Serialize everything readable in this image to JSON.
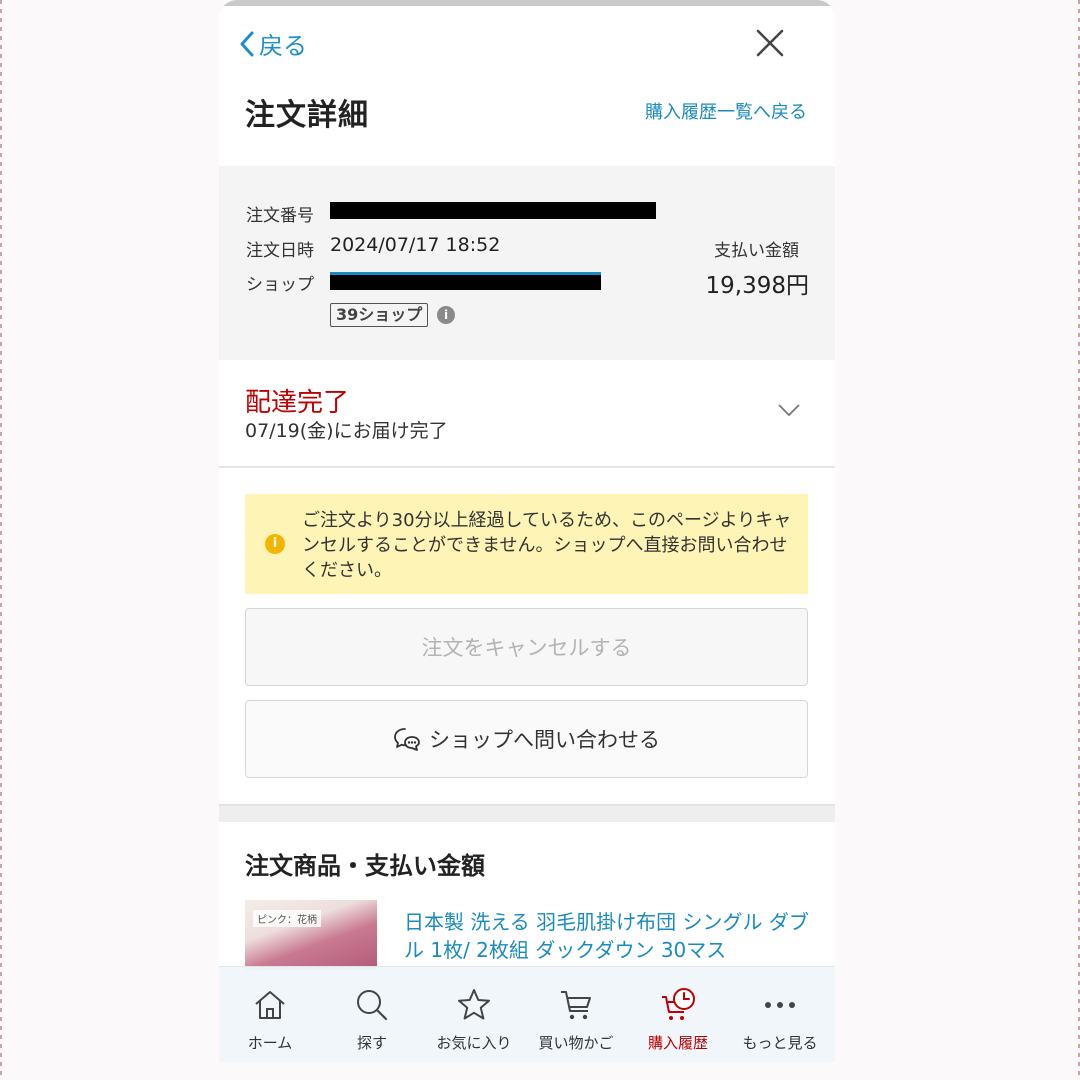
{
  "header": {
    "back_label": "戻る",
    "title": "注文詳細",
    "history_link": "購入履歴一覧へ戻る"
  },
  "order": {
    "number_label": "注文番号",
    "date_label": "注文日時",
    "date_value": "2024/07/17 18:52",
    "shop_label": "ショップ",
    "badge": "39ショップ",
    "payment_label": "支払い金額",
    "payment_value": "19,398円"
  },
  "status": {
    "title": "配達完了",
    "subtitle": "07/19(金)にお届け完了"
  },
  "notice": {
    "text": "ご注文より30分以上経過しているため、このページよりキャンセルすることができません。ショップへ直接お問い合わせください。"
  },
  "buttons": {
    "cancel": "注文をキャンセルする",
    "contact": "ショップへ問い合わせる"
  },
  "products": {
    "section_title": "注文商品・支払い金額",
    "item_tag": "ピンク：花柄",
    "item_name": "日本製 洗える 羽毛肌掛け布団 シングル ダブル 1枚/ 2枚組 ダックダウン 30マス"
  },
  "tabbar": {
    "items": [
      {
        "label": "ホーム",
        "icon": "home-icon"
      },
      {
        "label": "探す",
        "icon": "search-icon"
      },
      {
        "label": "お気に入り",
        "icon": "star-icon"
      },
      {
        "label": "買い物かご",
        "icon": "cart-icon"
      },
      {
        "label": "購入履歴",
        "icon": "purchase-history-icon",
        "active": true
      },
      {
        "label": "もっと見る",
        "icon": "more-icon"
      }
    ]
  },
  "colors": {
    "link": "#1a8bbf",
    "status_red": "#c00000",
    "notice_bg": "#fdf4b5",
    "notice_icon": "#f4b400"
  }
}
